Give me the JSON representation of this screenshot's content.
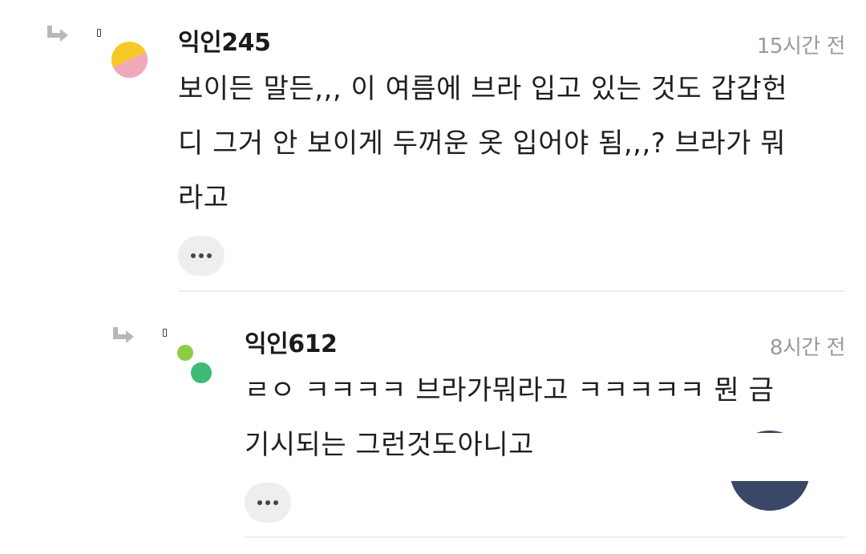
{
  "comments": [
    {
      "author": "익인245",
      "time": "15시간 전",
      "body_lines": [
        "보이든 말든,,, 이 여름에 브라 입고 있는 것도 갑갑헌",
        "디 그거 안 보이게 두꺼운 옷 입어야 됨,,,? 브라가 뭐",
        "라고"
      ],
      "avatar_colors": [
        "#f6c926",
        "#f0a9b9"
      ]
    },
    {
      "author": "익인612",
      "time": "8시간 전",
      "body_lines": [
        "ㄹㅇ ㅋㅋㅋㅋ 브라가뭐라고 ㅋㅋㅋㅋㅋ 뭔 금",
        "기시되는 그런것도아니고"
      ],
      "avatar_colors": [
        "#8fcc46",
        "#3dba75"
      ]
    }
  ],
  "colors": {
    "author_text": "#1b1b1b",
    "time_text": "#9a9a9a",
    "divider": "#eeeeee",
    "more_button_bg": "#eeeeee",
    "floating_badge": "#3a4767"
  },
  "icons": {
    "reply_arrow": "reply-arrow-icon",
    "more": "more-options-icon",
    "badge": "floating-badge"
  }
}
